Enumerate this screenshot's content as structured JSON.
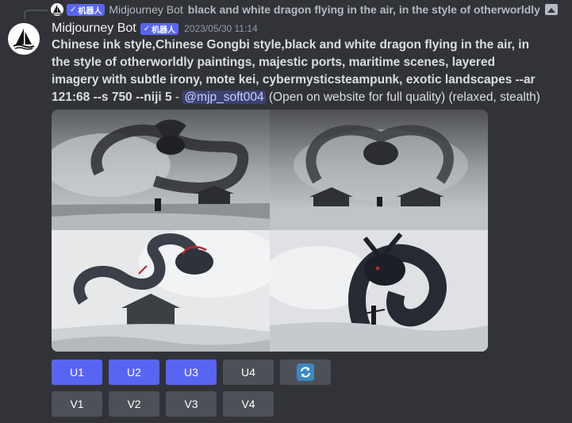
{
  "reply": {
    "author": "Midjourney Bot",
    "bot_tag": "机器人",
    "text": "black and white dragon flying in the air, in the style of otherworldly",
    "icon": "image-icon"
  },
  "message": {
    "author": "Midjourney Bot",
    "bot_tag": "机器人",
    "timestamp": "2023/05/30 11:14",
    "prompt": "Chinese ink style,Chinese Gongbi style,black and white dragon flying in the air, in the style of otherworldly paintings, majestic ports, maritime scenes, layered imagery with subtle irony, mote kei, cybermysticsteampunk, exotic landscapes --ar 121:68 --s 750 --niji 5",
    "separator": " - ",
    "mention": "@mjp_soft004",
    "note": " (Open on website for full quality) (relaxed, stealth)"
  },
  "images": [
    {
      "name": "dragon-image-1"
    },
    {
      "name": "dragon-image-2"
    },
    {
      "name": "dragon-image-3"
    },
    {
      "name": "dragon-image-4"
    }
  ],
  "buttons": {
    "upscale": [
      "U1",
      "U2",
      "U3",
      "U4"
    ],
    "variation": [
      "V1",
      "V2",
      "V3",
      "V4"
    ],
    "reroll_icon": "refresh-icon"
  },
  "colors": {
    "background": "#313338",
    "blurple": "#5865f2",
    "secondary_button": "#4e5058",
    "reroll_blue": "#3b88c3"
  }
}
